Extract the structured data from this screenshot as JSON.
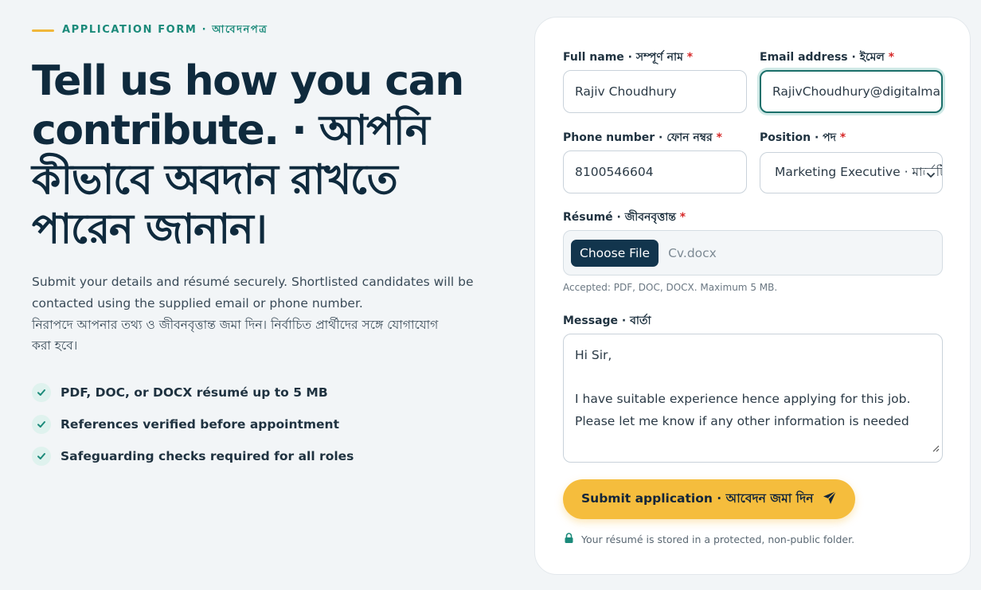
{
  "left": {
    "eyebrow": "APPLICATION FORM · আবেদনপত্র",
    "headline": "Tell us how you can contribute. · আপনি কীভাবে অবদান রাখতে পারেন জানান।",
    "intro_en": "Submit your details and résumé securely. Shortlisted candidates will be contacted using the supplied email or phone number.",
    "intro_bn": "নিরাপদে আপনার তথ্য ও জীবনবৃত্তান্ত জমা দিন। নির্বাচিত প্রার্থীদের সঙ্গে যোগাযোগ করা হবে।",
    "checks": [
      "PDF, DOC, or DOCX résumé up to 5 MB",
      "References verified before appointment",
      "Safeguarding checks required for all roles"
    ]
  },
  "form": {
    "full_name_label": "Full name · সম্পূর্ণ নাম",
    "full_name_value": "Rajiv Choudhury",
    "email_label": "Email address · ইমেল",
    "email_value": "RajivChoudhury@digitalmarketing.com",
    "phone_label": "Phone number · ফোন নম্বর",
    "phone_value": "8100546604",
    "position_label": "Position · পদ",
    "position_value": "Marketing Executive · মার্কেটিং এক্সিকিউটিভ",
    "resume_label": "Résumé · জীবনবৃত্তান্ত",
    "choose_file": "Choose File",
    "file_name": "Cv.docx",
    "resume_hint": "Accepted: PDF, DOC, DOCX. Maximum 5 MB.",
    "message_label": "Message · বার্তা",
    "message_lines": [
      "Hi Sir,",
      "",
      "I have suitable experience hence applying for this job.",
      "Please let me know if any other information is needed"
    ],
    "required_marker": "*",
    "submit_label": "Submit application · আবেদন জমা দিন",
    "secure_note": "Your résumé is stored in a protected, non-public folder."
  },
  "icons": {
    "check": "check-icon",
    "chevron": "chevron-down-icon",
    "send": "send-icon",
    "lock": "lock-icon"
  },
  "colors": {
    "accent_teal": "#1b8a7a",
    "accent_yellow": "#f5bd3d",
    "navy": "#0f2a3d",
    "required": "#d62828"
  }
}
